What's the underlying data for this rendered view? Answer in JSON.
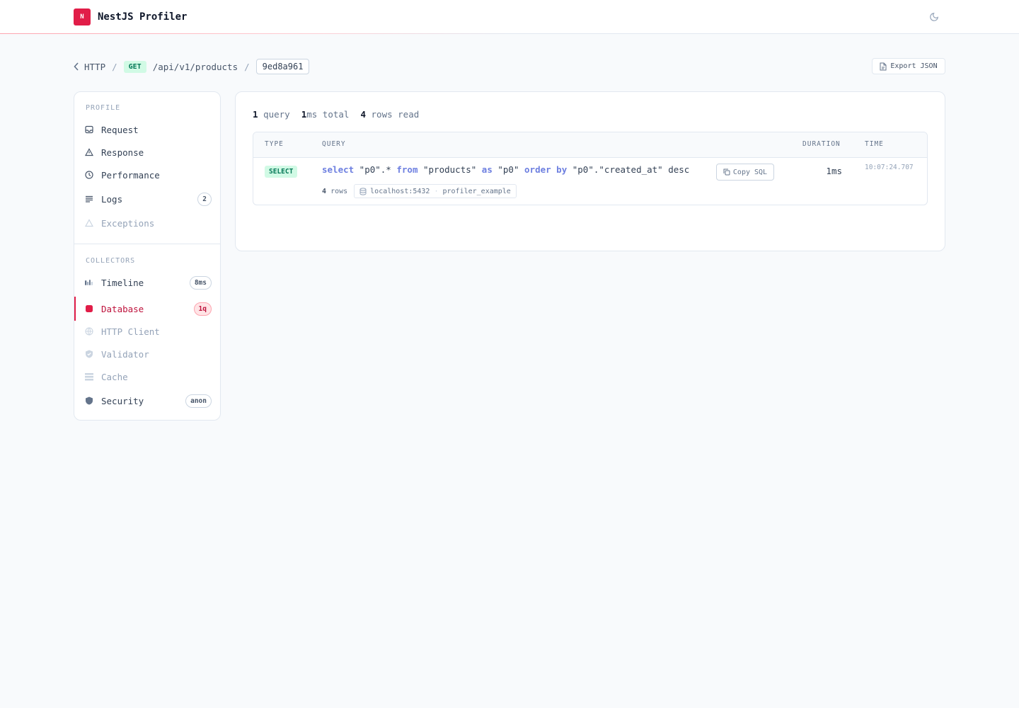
{
  "app": {
    "logo_letter": "N",
    "title": "NestJS Profiler",
    "accent": "#e11d48"
  },
  "header": {
    "theme_toggle_icon": "moon-icon"
  },
  "breadcrumb": {
    "back_label": "HTTP",
    "separator": "/",
    "method": "GET",
    "path": "/api/v1/products",
    "token": "9ed8a961"
  },
  "toolbar": {
    "export_label": "Export JSON"
  },
  "sidebar": {
    "profile_title": "PROFILE",
    "profile_items": [
      {
        "label": "Request",
        "icon": "inbox-icon"
      },
      {
        "label": "Response",
        "icon": "triangle-icon"
      },
      {
        "label": "Performance",
        "icon": "clock-icon"
      },
      {
        "label": "Logs",
        "icon": "list-icon",
        "count": "2"
      },
      {
        "label": "Exceptions",
        "icon": "warning-icon"
      }
    ],
    "collectors_title": "COLLECTORS",
    "collector_items": [
      {
        "label": "Timeline",
        "icon": "bar-chart-icon",
        "count": "8ms"
      },
      {
        "label": "Database",
        "icon": "database-icon",
        "count": "1q",
        "active": true
      },
      {
        "label": "HTTP Client",
        "icon": "globe-icon"
      },
      {
        "label": "Validator",
        "icon": "shield-check-icon"
      },
      {
        "label": "Cache",
        "icon": "layers-icon"
      },
      {
        "label": "Security",
        "icon": "shield-icon",
        "count": "anon"
      }
    ]
  },
  "summary": {
    "query_count": "1",
    "query_label": "query",
    "total_ms": "1",
    "total_label": "ms total",
    "rows_read": "4",
    "rows_label": "rows read"
  },
  "queries_table": {
    "columns": [
      "TYPE",
      "QUERY",
      "DURATION",
      "TIME"
    ],
    "rows": [
      {
        "type": "SELECT",
        "sql_tokens": [
          {
            "t": "select",
            "kw": true
          },
          {
            "t": " \"p0\".* "
          },
          {
            "t": "from",
            "kw": true
          },
          {
            "t": " \"products\" "
          },
          {
            "t": "as",
            "kw": true
          },
          {
            "t": " \"p0\" "
          },
          {
            "t": "order by",
            "kw": true
          },
          {
            "t": " \"p0\".\"created_at\" desc"
          }
        ],
        "copy_label": "Copy SQL",
        "rows_count": "4",
        "rows_label": "rows",
        "connection": "localhost:5432",
        "database": "profiler_example",
        "duration": "1ms",
        "time": "10:07:24.707"
      }
    ]
  }
}
